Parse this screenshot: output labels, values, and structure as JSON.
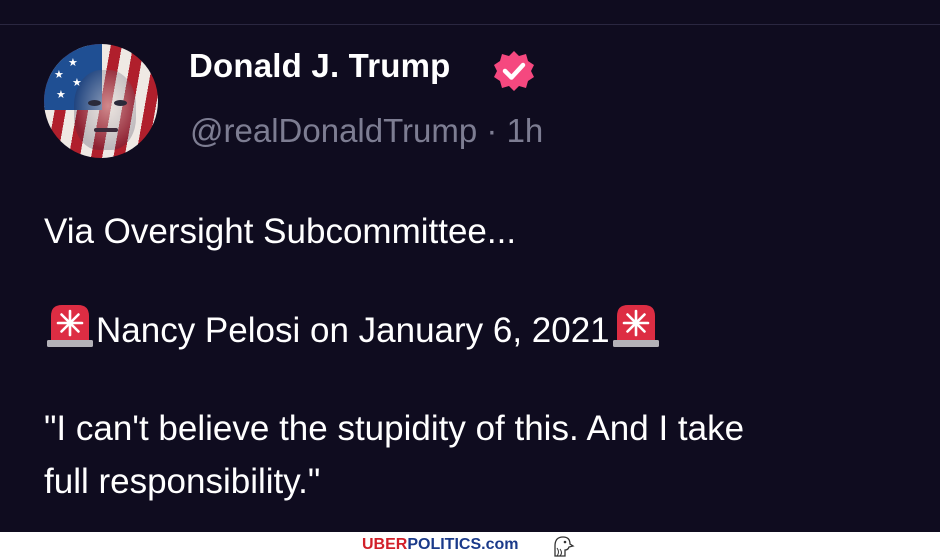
{
  "post": {
    "author": {
      "display_name": "Donald J. Trump",
      "handle": "@realDonaldTrump",
      "separator": "·",
      "time": "1h",
      "verified_badge_color": "#f5487f",
      "avatar_icon": "flag-portrait-avatar"
    },
    "body": {
      "line1": "Via Oversight Subcommittee...",
      "line2": "Nancy Pelosi on January 6, 2021",
      "line3": "\"I can't believe the stupidity of this. And I take",
      "line4": "full responsibility.\"",
      "emoji_icon": "siren-icon"
    },
    "background_color": "#0f0c1f"
  },
  "watermark": {
    "brand_part1": "UBER",
    "brand_part2": "POLITICS",
    "brand_part3": ".com",
    "icon": "eagle-icon",
    "color_uber": "#d2202a",
    "color_rest": "#1a3a8a"
  }
}
